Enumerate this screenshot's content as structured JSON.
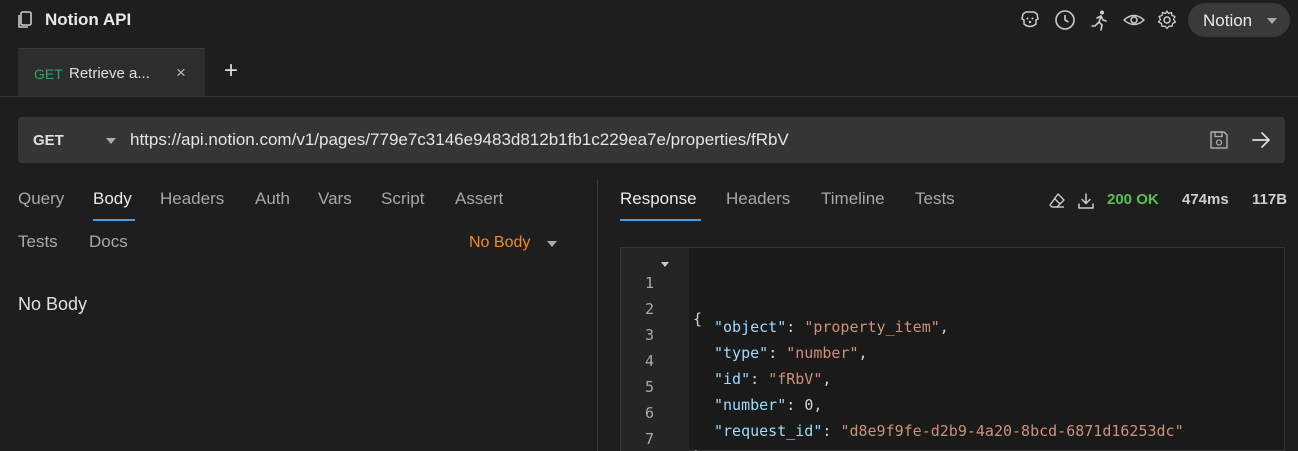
{
  "app": {
    "title": "Notion API",
    "workspace": "Notion"
  },
  "top_icons": [
    "dog-icon",
    "clock-icon",
    "runner-icon",
    "eye-icon",
    "gear-icon"
  ],
  "tabs": [
    {
      "method": "GET",
      "name": "Retrieve a...",
      "close": "×"
    }
  ],
  "tab_add": "+",
  "request": {
    "method": "GET",
    "url": "https://api.notion.com/v1/pages/779e7c3146e9483d812b1fb1c229ea7e/properties/fRbV"
  },
  "request_tabs": [
    "Query",
    "Body",
    "Headers",
    "Auth",
    "Vars",
    "Script",
    "Assert",
    "Tests",
    "Docs"
  ],
  "request_active_tab": "Body",
  "body_mode": "No Body",
  "body_content": "No Body",
  "response_tabs": [
    "Response",
    "Headers",
    "Timeline",
    "Tests"
  ],
  "response_active_tab": "Response",
  "response": {
    "status": "200 OK",
    "time": "474ms",
    "size": "117B",
    "lines": [
      {
        "no": "1",
        "text": "{"
      },
      {
        "no": "2",
        "key": "\"object\"",
        "sep": ": ",
        "val": "\"property_item\"",
        "end": ",",
        "vtype": "s"
      },
      {
        "no": "3",
        "key": "\"type\"",
        "sep": ": ",
        "val": "\"number\"",
        "end": ",",
        "vtype": "s"
      },
      {
        "no": "4",
        "key": "\"id\"",
        "sep": ": ",
        "val": "\"fRbV\"",
        "end": ",",
        "vtype": "s"
      },
      {
        "no": "5",
        "key": "\"number\"",
        "sep": ": ",
        "val": "0",
        "end": ",",
        "vtype": "n"
      },
      {
        "no": "6",
        "key": "\"request_id\"",
        "sep": ": ",
        "val": "\"d8e9f9fe-d2b9-4a20-8bcd-6871d16253dc\"",
        "end": "",
        "vtype": "s"
      },
      {
        "no": "7",
        "text": "}"
      }
    ]
  },
  "colors": {
    "get_method": "#2da66a",
    "body_mode": "#f28b22",
    "status_ok": "#57c14e",
    "active_underline": "#4a9ee0"
  }
}
